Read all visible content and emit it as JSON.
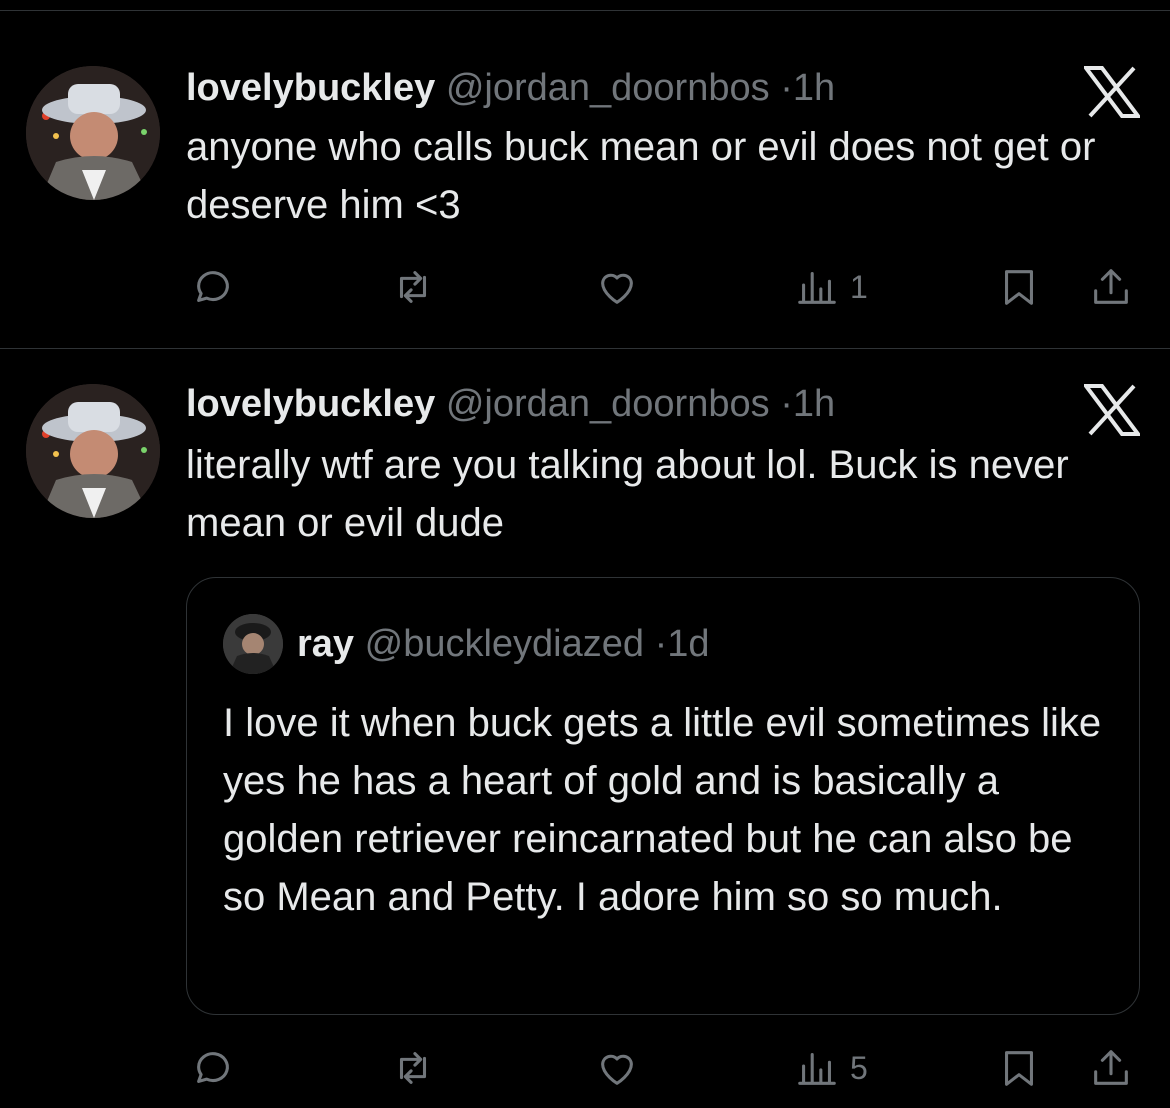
{
  "tweets": [
    {
      "display_name": "lovelybuckley",
      "handle": "@jordan_doornbos",
      "separator": "·",
      "time": "1h",
      "text": "anyone who calls buck mean or evil does not get or deserve him <3",
      "views": "1",
      "avatar_icon": "user-avatar-icon"
    },
    {
      "display_name": "lovelybuckley",
      "handle": "@jordan_doornbos",
      "separator": "·",
      "time": "1h",
      "text": "literally wtf are you talking about lol. Buck is never mean or evil dude",
      "views": "5",
      "avatar_icon": "user-avatar-icon",
      "quote": {
        "display_name": "ray",
        "handle": "@buckleydiazed",
        "separator": "·",
        "time": "1d",
        "text": "I love it when buck gets a little evil sometimes like yes he has a heart of gold and is basically a golden retriever reincarnated but he can also be so Mean and Petty. I adore him so so much."
      }
    }
  ],
  "icons": {
    "reply": "comment-icon",
    "retweet": "retweet-icon",
    "like": "heart-icon",
    "views": "views-bars-icon",
    "bookmark": "bookmark-icon",
    "share": "share-icon",
    "brand": "x-logo-icon"
  },
  "colors": {
    "background": "#000000",
    "text": "#e7e9ea",
    "muted": "#71767b",
    "border": "#2f3336"
  }
}
